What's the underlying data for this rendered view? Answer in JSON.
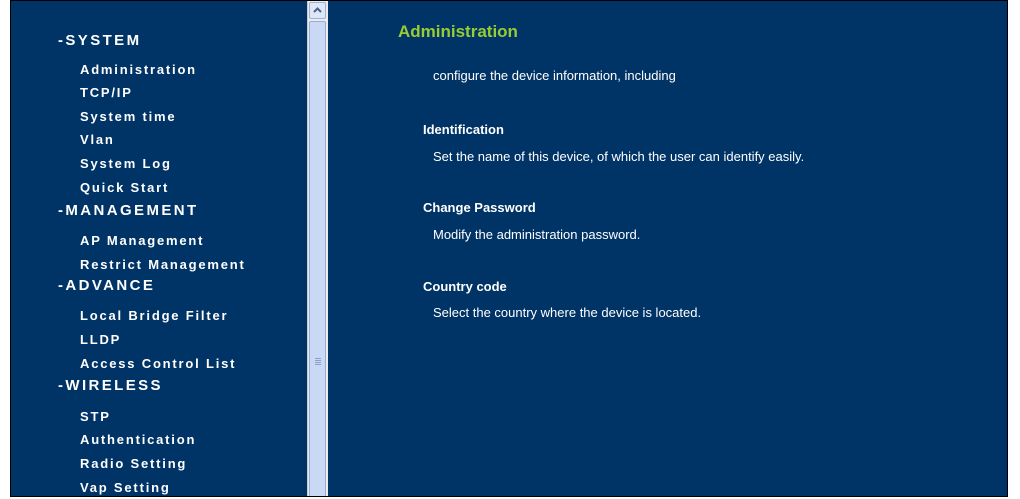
{
  "sidebar": {
    "groups": [
      {
        "heading": "-SYSTEM",
        "items": [
          "Administration",
          "TCP/IP",
          "System time",
          "Vlan",
          "System Log",
          "Quick Start"
        ]
      },
      {
        "heading": "-MANAGEMENT",
        "items": [
          "AP Management",
          "Restrict Management"
        ]
      },
      {
        "heading": "-ADVANCE",
        "items": [
          "Local Bridge Filter",
          "LLDP",
          "Access Control List"
        ]
      },
      {
        "heading": "-WIRELESS",
        "items": [
          "STP",
          "Authentication",
          "Radio Setting",
          "Vap Setting"
        ]
      }
    ]
  },
  "main": {
    "title": "Administration",
    "intro": "configure the device information, including",
    "sections": [
      {
        "title": "Identification",
        "description": "Set the name of this device, of which the user can identify easily."
      },
      {
        "title": "Change Password",
        "description": "Modify the administration password."
      },
      {
        "title": "Country code",
        "description": "Select the country where the device is located."
      }
    ]
  },
  "colors": {
    "background": "#003366",
    "title_accent": "#99cc33",
    "text": "#ffffff"
  },
  "icons": {
    "scroll_up": "chevron-up-icon"
  }
}
